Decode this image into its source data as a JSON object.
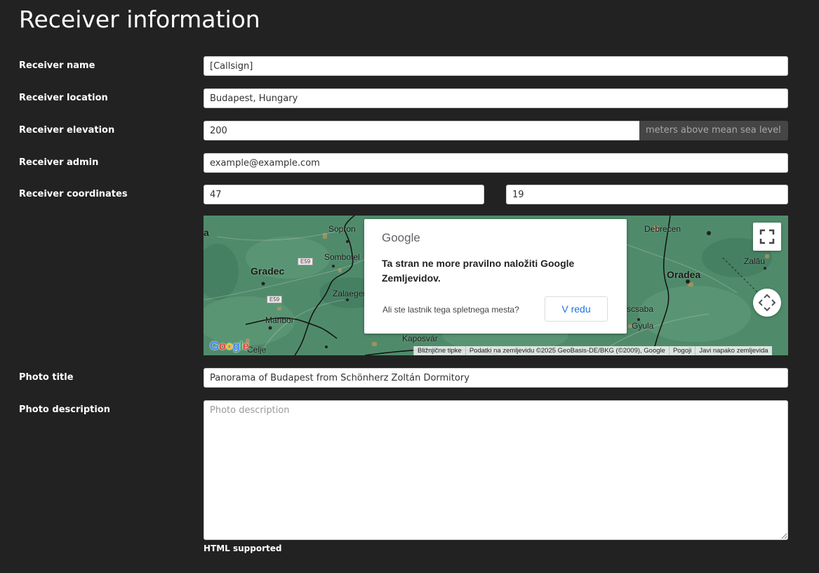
{
  "page": {
    "title": "Receiver information"
  },
  "form": {
    "receiver_name": {
      "label": "Receiver name",
      "value": "[Callsign]"
    },
    "receiver_location": {
      "label": "Receiver location",
      "value": "Budapest, Hungary"
    },
    "receiver_elevation": {
      "label": "Receiver elevation",
      "value": "200",
      "unit": "meters above mean sea level"
    },
    "receiver_admin": {
      "label": "Receiver admin",
      "value": "example@example.com"
    },
    "receiver_coordinates": {
      "label": "Receiver coordinates",
      "lat": "47",
      "lon": "19"
    },
    "photo_title": {
      "label": "Photo title",
      "value": "Panorama of Budapest from Schönherz Zoltán Dormitory"
    },
    "photo_description": {
      "label": "Photo description",
      "placeholder": "Photo description",
      "value": "",
      "hint": "HTML supported"
    }
  },
  "map": {
    "place_labels": [
      "Sopron",
      "Gradec",
      "Sombotel",
      "Zalaeger",
      "Maribor",
      "Kaposvár",
      "Debrecen",
      "Zalău",
      "Oradea",
      "Gyula",
      "scsaba",
      "Celje",
      "a"
    ],
    "road_shields": [
      "E59",
      "E59"
    ],
    "google_logo": "Google",
    "attribution": {
      "shortcuts": "Bližnjične tipke",
      "data": "Podatki na zemljevidu ©2025 GeoBasis-DE/BKG (©2009), Google",
      "terms": "Pogoji",
      "report": "Javi napako zemljevida"
    },
    "dialog": {
      "logo": "Google",
      "message": "Ta stran ne more pravilno naložiti Google Zemljevidov.",
      "owner_question": "Ali ste lastnik tega spletnega mesta?",
      "ok_button": "V redu"
    },
    "icons": {
      "fullscreen": "fullscreen-icon",
      "pan": "pan-control-icon"
    },
    "colors": {
      "land": "#4e8a6a",
      "border": "#111111",
      "ok_text": "#1a73e8"
    }
  },
  "colors": {
    "background": "#222222",
    "text": "#ffffff",
    "addon_bg": "#454545"
  }
}
